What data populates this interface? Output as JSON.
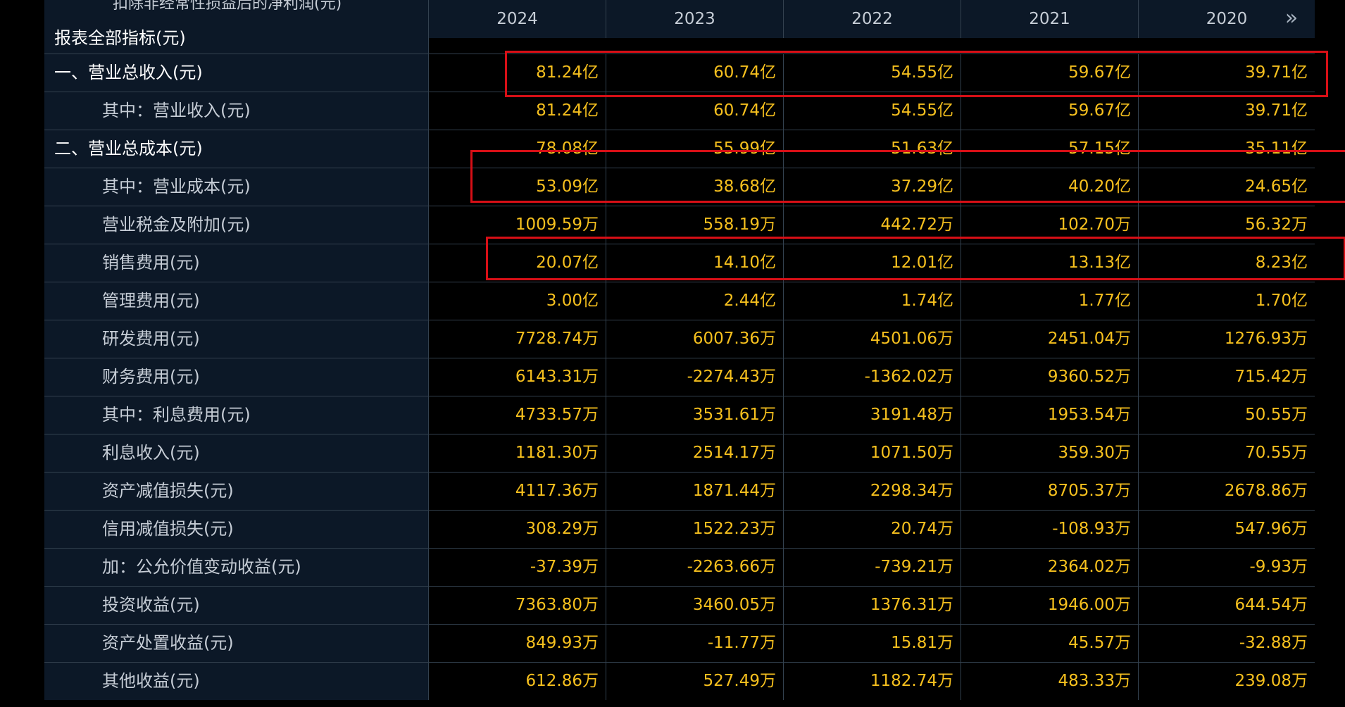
{
  "table": {
    "truncated_label": "扣除非经常性损益后的净利润(元)",
    "report_label": "报表全部指标(元)",
    "years": [
      "2024",
      "2023",
      "2022",
      "2021",
      "2020"
    ],
    "rows": [
      {
        "label": "一、营业总收入(元)",
        "values": [
          "81.24亿",
          "60.74亿",
          "54.55亿",
          "59.67亿",
          "39.71亿"
        ]
      },
      {
        "label": "其中：营业收入(元)",
        "values": [
          "81.24亿",
          "60.74亿",
          "54.55亿",
          "59.67亿",
          "39.71亿"
        ]
      },
      {
        "label": "二、营业总成本(元)",
        "values": [
          "78.08亿",
          "55.99亿",
          "51.63亿",
          "57.15亿",
          "35.11亿"
        ]
      },
      {
        "label": "其中：营业成本(元)",
        "values": [
          "53.09亿",
          "38.68亿",
          "37.29亿",
          "40.20亿",
          "24.65亿"
        ]
      },
      {
        "label": "营业税金及附加(元)",
        "values": [
          "1009.59万",
          "558.19万",
          "442.72万",
          "102.70万",
          "56.32万"
        ]
      },
      {
        "label": "销售费用(元)",
        "values": [
          "20.07亿",
          "14.10亿",
          "12.01亿",
          "13.13亿",
          "8.23亿"
        ]
      },
      {
        "label": "管理费用(元)",
        "values": [
          "3.00亿",
          "2.44亿",
          "1.74亿",
          "1.77亿",
          "1.70亿"
        ]
      },
      {
        "label": "研发费用(元)",
        "values": [
          "7728.74万",
          "6007.36万",
          "4501.06万",
          "2451.04万",
          "1276.93万"
        ]
      },
      {
        "label": "财务费用(元)",
        "values": [
          "6143.31万",
          "-2274.43万",
          "-1362.02万",
          "9360.52万",
          "715.42万"
        ]
      },
      {
        "label": "其中：利息费用(元)",
        "values": [
          "4733.57万",
          "3531.61万",
          "3191.48万",
          "1953.54万",
          "50.55万"
        ]
      },
      {
        "label": "利息收入(元)",
        "values": [
          "1181.30万",
          "2514.17万",
          "1071.50万",
          "359.30万",
          "70.55万"
        ]
      },
      {
        "label": "资产减值损失(元)",
        "values": [
          "4117.36万",
          "1871.44万",
          "2298.34万",
          "8705.37万",
          "2678.86万"
        ]
      },
      {
        "label": "信用减值损失(元)",
        "values": [
          "308.29万",
          "1522.23万",
          "20.74万",
          "-108.93万",
          "547.96万"
        ]
      },
      {
        "label": "加：公允价值变动收益(元)",
        "values": [
          "-37.39万",
          "-2263.66万",
          "-739.21万",
          "2364.02万",
          "-9.93万"
        ]
      },
      {
        "label": "投资收益(元)",
        "values": [
          "7363.80万",
          "3460.05万",
          "1376.31万",
          "1946.00万",
          "644.54万"
        ]
      },
      {
        "label": "资产处置收益(元)",
        "values": [
          "849.93万",
          "-11.77万",
          "15.81万",
          "45.57万",
          "-32.88万"
        ]
      },
      {
        "label": "其他收益(元)",
        "values": [
          "612.86万",
          "527.49万",
          "1182.74万",
          "483.33万",
          "239.08万"
        ]
      }
    ]
  },
  "icons": {
    "more": "double-chevron-right-icon"
  },
  "colors": {
    "background": "#000000",
    "label_background": "#0c1827",
    "grid": "#33414f",
    "value_text": "#f6c01e",
    "label_text": "#c6cdd6",
    "highlight": "#d70f16"
  }
}
